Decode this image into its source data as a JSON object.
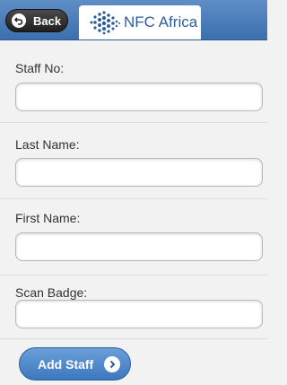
{
  "header": {
    "back_label": "Back",
    "logo_text": "NFC Africa",
    "colors": {
      "bar": "#4a7fbf",
      "logo_text": "#2f5f9a"
    }
  },
  "form": {
    "fields": [
      {
        "label": "Staff No:",
        "value": ""
      },
      {
        "label": "Last Name:",
        "value": ""
      },
      {
        "label": "First Name:",
        "value": ""
      },
      {
        "label": "Scan Badge:",
        "value": ""
      }
    ],
    "submit_label": "Add Staff"
  }
}
